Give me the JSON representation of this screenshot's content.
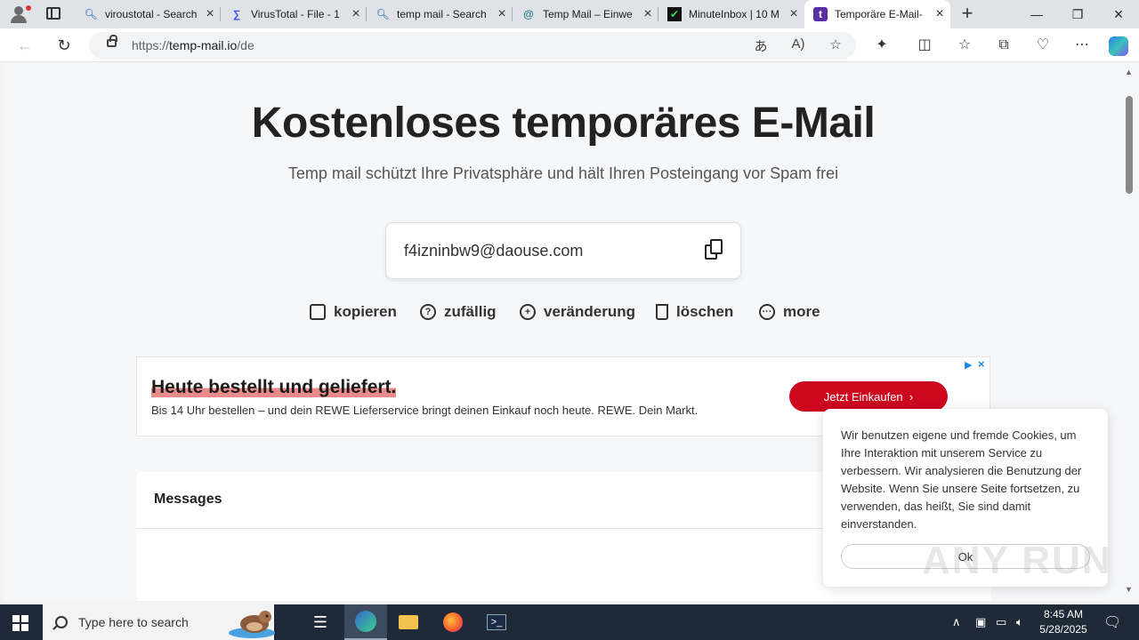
{
  "browser": {
    "tabs": [
      {
        "title": "viroustotal - Search",
        "favicon": "search-icon"
      },
      {
        "title": "VirusTotal - File - 1",
        "favicon": "virustotal-icon"
      },
      {
        "title": "temp mail - Search",
        "favicon": "search-icon"
      },
      {
        "title": "Temp Mail – Einwe",
        "favicon": "at-icon"
      },
      {
        "title": "MinuteInbox | 10 M",
        "favicon": "minuteinbox-icon"
      },
      {
        "title": "Temporäre E-Mail-",
        "favicon": "tempmail-icon"
      }
    ],
    "active_tab_index": 5,
    "url_prefix": "https://",
    "url_host": "temp-mail.io",
    "url_path": "/de"
  },
  "page": {
    "title": "Kostenloses temporäres E-Mail",
    "subtitle": "Temp mail schützt Ihre Privatsphäre und hält Ihren Posteingang vor Spam frei",
    "email": "f4izninbw9@daouse.com",
    "actions": [
      {
        "label": "kopieren",
        "icon": "copy-icon"
      },
      {
        "label": "zufällig",
        "icon": "question-icon"
      },
      {
        "label": "veränderung",
        "icon": "plus-circle-icon"
      },
      {
        "label": "löschen",
        "icon": "trash-icon"
      },
      {
        "label": "more",
        "icon": "more-icon"
      }
    ],
    "ad": {
      "headline": "Heute bestellt und geliefert.",
      "text": "Bis 14 Uhr bestellen – und dein REWE Lieferservice bringt deinen Einkauf noch heute. REWE. Dein Markt.",
      "button": "Jetzt Einkaufen"
    },
    "messages_header": "Messages",
    "cookie": {
      "text": "Wir benutzen eigene und fremde Cookies, um Ihre Interaktion mit unserem Service zu verbessern. Wir analysieren die Benutzung der Website. Wenn Sie unsere Seite fortsetzen, zu verwenden, das heißt, Sie sind damit einverstanden.",
      "ok": "Ok"
    },
    "watermark": "ANY RUN"
  },
  "taskbar": {
    "search_placeholder": "Type here to search",
    "time": "8:45 AM",
    "date": "5/28/2025"
  }
}
